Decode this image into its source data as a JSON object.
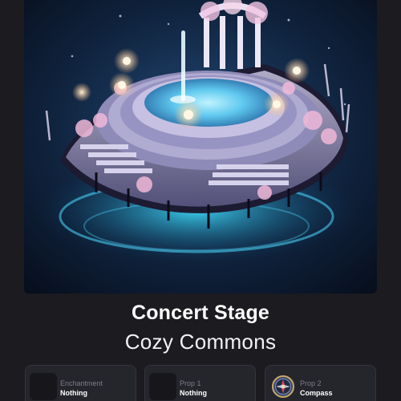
{
  "item": {
    "title": "Concert Stage",
    "collection": "Cozy Commons"
  },
  "slots": [
    {
      "label": "Enchantment",
      "value": "Nothing",
      "icon": "empty-slot-icon"
    },
    {
      "label": "Prop 1",
      "value": "Nothing",
      "icon": "empty-slot-icon"
    },
    {
      "label": "Prop 2",
      "value": "Compass",
      "icon": "compass-icon"
    }
  ],
  "colors": {
    "background": "#1b1b20",
    "slot_background": "#25252c",
    "label_muted": "#7d7d88",
    "text_primary": "#ffffff"
  }
}
